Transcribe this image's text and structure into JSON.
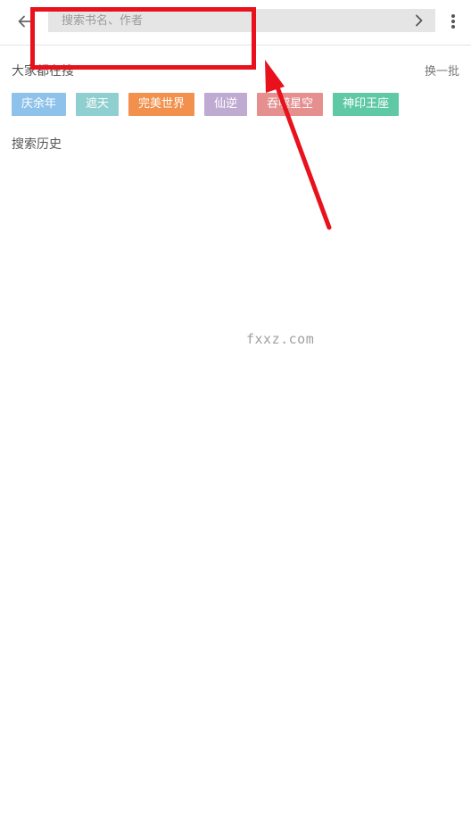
{
  "search": {
    "placeholder": "搜索书名、作者",
    "value": ""
  },
  "icons": {
    "back": "arrow-left-icon",
    "go": "chevron-right-icon",
    "more": "more-vertical-icon"
  },
  "hot": {
    "title": "大家都在搜",
    "refresh_label": "换一批",
    "tags": [
      {
        "label": "庆余年",
        "color": "#8ec2ea"
      },
      {
        "label": "遮天",
        "color": "#8fcfcf"
      },
      {
        "label": "完美世界",
        "color": "#f2914d"
      },
      {
        "label": "仙逆",
        "color": "#bfaad2"
      },
      {
        "label": "吞噬星空",
        "color": "#e58f8f"
      },
      {
        "label": "神印王座",
        "color": "#5fc9a6"
      }
    ]
  },
  "history": {
    "title": "搜索历史"
  },
  "watermark": "fxxz.com",
  "annotation": {
    "color": "#e8111c"
  }
}
